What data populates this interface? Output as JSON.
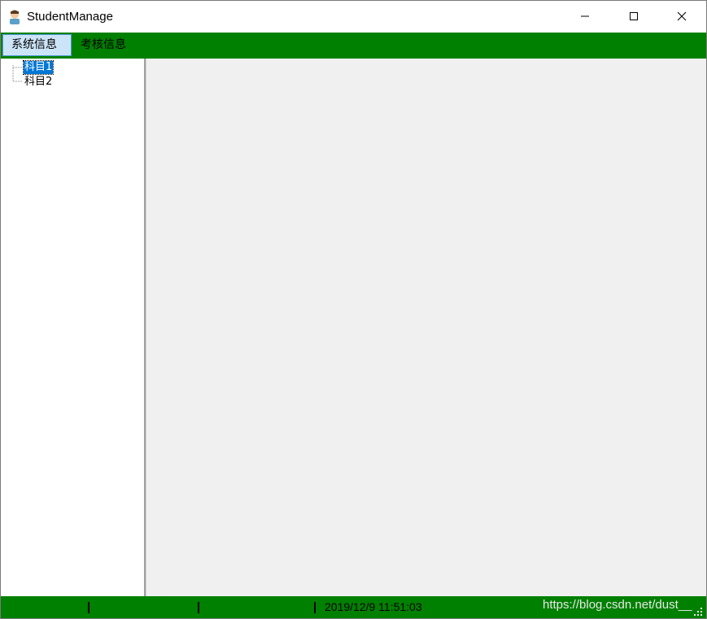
{
  "window": {
    "title": "StudentManage",
    "icon": "student-avatar-icon",
    "controls": [
      "minimize-icon",
      "maximize-icon",
      "close-icon"
    ]
  },
  "menu": {
    "items": [
      {
        "label": "系统信息",
        "active": true
      },
      {
        "label": "考核信息",
        "active": false
      }
    ]
  },
  "tree": {
    "nodes": [
      {
        "label": "科目1",
        "selected": true
      },
      {
        "label": "科目2",
        "selected": false
      }
    ]
  },
  "status": {
    "datetime": "2019/12/9 11:51:03",
    "watermark": "https://blog.csdn.net/dust__"
  },
  "colors": {
    "menubar": "#008000",
    "statusbar": "#008000",
    "selection": "#0078d7",
    "active_menu": "#cce4f7",
    "content_bg": "#f0f0f0"
  }
}
